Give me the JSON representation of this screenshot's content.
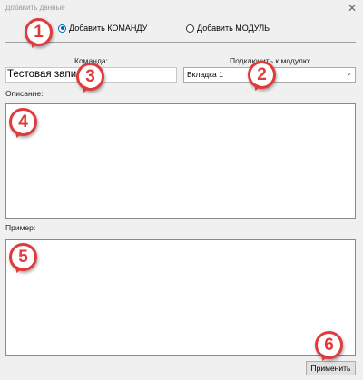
{
  "window": {
    "title": "Добавить данные",
    "close_glyph": "✕"
  },
  "mode": {
    "option1": "Добавить КОМАНДУ",
    "option2": "Добавить МОДУЛЬ",
    "selected": "option1"
  },
  "command": {
    "label": "Команда:",
    "value": "Тестовая запись"
  },
  "module": {
    "label": "Подключить к модулю:",
    "value": "Вкладка 1",
    "chevron": "⌄"
  },
  "description": {
    "label": "Описание:",
    "value": ""
  },
  "example": {
    "label": "Пример:",
    "value": ""
  },
  "apply_button": "Применить",
  "badges": [
    "1",
    "2",
    "3",
    "4",
    "5",
    "6"
  ],
  "colors": {
    "badge": "#e03a3a",
    "accent": "#0063b1"
  }
}
